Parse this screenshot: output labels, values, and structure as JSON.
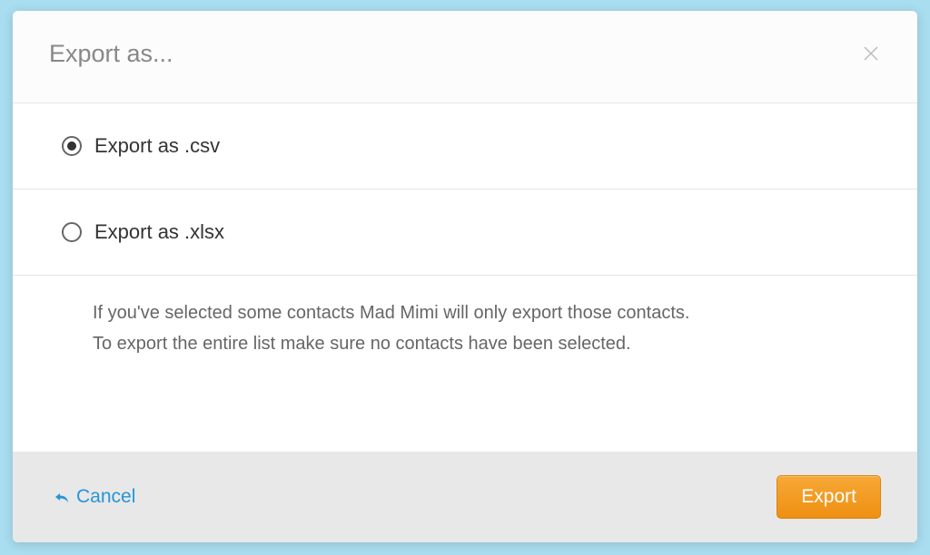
{
  "modal": {
    "title": "Export as...",
    "options": [
      {
        "label": "Export as .csv",
        "selected": true
      },
      {
        "label": "Export as .xlsx",
        "selected": false
      }
    ],
    "info_line1": "If you've selected some contacts Mad Mimi will only export those contacts.",
    "info_line2": "To export the entire list make sure no contacts have been selected.",
    "cancel_label": "Cancel",
    "export_label": "Export"
  }
}
